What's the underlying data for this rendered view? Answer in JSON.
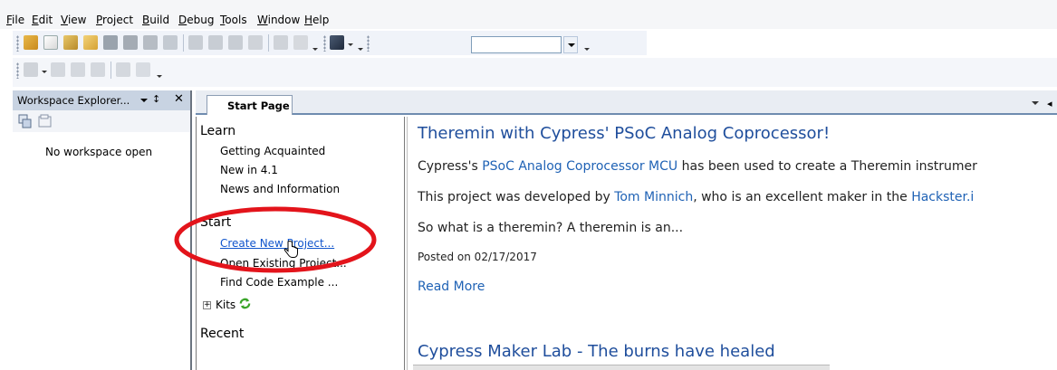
{
  "menu": {
    "items": [
      {
        "id": "file",
        "underline": "F",
        "rest": "ile"
      },
      {
        "id": "edit",
        "underline": "E",
        "rest": "dit"
      },
      {
        "id": "view",
        "underline": "V",
        "rest": "iew"
      },
      {
        "id": "project",
        "underline": "P",
        "rest": "roject"
      },
      {
        "id": "build",
        "underline": "B",
        "rest": "uild"
      },
      {
        "id": "debug",
        "underline": "D",
        "rest": "ebug"
      },
      {
        "id": "tools",
        "underline": "T",
        "rest": "ools"
      },
      {
        "id": "window",
        "underline": "W",
        "rest": "indow"
      },
      {
        "id": "help",
        "underline": "H",
        "rest": "elp"
      }
    ]
  },
  "workspace": {
    "title": "Workspace Explorer...",
    "pin": "↕",
    "close": "✕",
    "empty_text": "No workspace open"
  },
  "tabs": {
    "start_page": "Start Page",
    "scroll": "◂"
  },
  "start_page": {
    "learn": {
      "heading": "Learn",
      "links": [
        "Getting Acquainted",
        "New in 4.1",
        "News and Information"
      ]
    },
    "start": {
      "heading": "Start",
      "links": [
        "Create New Project...",
        "Open Existing Project...",
        "Find Code Example ..."
      ]
    },
    "kits": {
      "toggle": "+",
      "label": "Kits"
    },
    "recent": {
      "heading": "Recent"
    }
  },
  "news": {
    "title": "Theremin with Cypress' PSoC Analog Coprocessor!",
    "line1_pre": "Cypress's ",
    "line1_link": "PSoC Analog Coprocessor MCU",
    "line1_post": " has been used to create a Theremin instrumer",
    "line2_pre": "This project was developed by ",
    "line2_link1": "Tom Minnich",
    "line2_mid": ", who is an excellent maker in the ",
    "line2_link2": "Hackster.i",
    "line3": "So what is a theremin? A theremin is an...",
    "posted": "Posted on 02/17/2017",
    "read_more": "Read More",
    "next_title": "Cypress Maker Lab - The burns have healed"
  },
  "colors": {
    "link": "#1f62b5",
    "title": "#1f4e9c",
    "highlight": "#e3141b",
    "panel_header": "#c8d3e2"
  }
}
